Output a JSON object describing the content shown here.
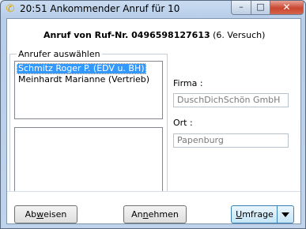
{
  "window": {
    "title": "20:51 Ankommender Anruf für 10",
    "icon": "phone-icon",
    "controls": {
      "minimize": "–",
      "maximize": "□",
      "close": "✕"
    }
  },
  "header": {
    "prefix": "Anruf von Ruf-Nr. 0496598127613",
    "attempt": "(6. Versuch)"
  },
  "caller_group": {
    "label": "Anrufer auswählen",
    "callers": [
      {
        "name": "Schmitz Roger P. (EDV u. BH)",
        "selected": true
      },
      {
        "name": "Meinhardt Marianne (Vertrieb)",
        "selected": false
      }
    ]
  },
  "details": {
    "company_label": "Firma :",
    "company_value": "DuschDichSchön GmbH",
    "city_label": "Ort :",
    "city_value": "Papenburg"
  },
  "buttons": {
    "reject": {
      "pre": "Ab",
      "key": "w",
      "post": "eisen"
    },
    "accept": {
      "pre": "An",
      "key": "n",
      "post": "ehmen"
    },
    "ask": {
      "pre": "",
      "key": "U",
      "post": "mfrage"
    }
  },
  "colors": {
    "selection": "#3399ff",
    "title_bar": "#c9dcf1",
    "close_button": "#c84630"
  }
}
